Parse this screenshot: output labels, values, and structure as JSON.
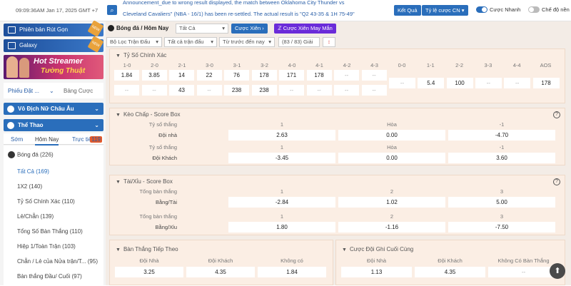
{
  "topbar": {
    "clock": "09:09:36AM Jan 17, 2025 GMT +7",
    "ticker_line1": "Announcement_due to wrong result displayed, the match between  Oklahoma City Thunder  vs",
    "ticker_line2": "Cleveland Cavaliers\" (NBA - 16/1) has been re-settled. The actual result is \"Q2 43-35 & 1H 75-49\"",
    "result_button": "Kết Quả",
    "odds_button": "Tỷ lệ cược CN",
    "odds_chevron": "▾",
    "quick_bet_label": "Cược Nhanh",
    "mode_label": "Chế độ nền",
    "colors": {
      "accent": "#2a6ebb",
      "peach": "#fbeee4"
    }
  },
  "sidebar": {
    "promo1": "Phiên bản Rút Gọn",
    "promo1_tag": "NEW",
    "promo2": "Galaxy",
    "promo2_tag": "NEW",
    "banner_line1": "Hot Streamer",
    "banner_line2": "Tường Thuật",
    "tab_bets": "Phiếu Đặt ...",
    "tab_bets_chevron": "⌄",
    "tab_table": "Bảng Cược",
    "section1": "Vô Địch Nữ Châu Âu",
    "section2": "Thể Thao",
    "chevron": "⌄",
    "sport_tabs": [
      "Sớm",
      "Hôm Nay",
      "Trực tiếp"
    ],
    "live_count": "119",
    "football": "Bóng đá",
    "football_count": "(226)",
    "menu": [
      {
        "label": "Tất Cả",
        "count": "(169)"
      },
      {
        "label": "1X2",
        "count": "(140)"
      },
      {
        "label": "Tỷ Số Chính Xác",
        "count": "(110)"
      },
      {
        "label": "Lẻ/Chẵn",
        "count": "(139)"
      },
      {
        "label": "Tổng Số Bàn Thắng",
        "count": "(110)"
      },
      {
        "label": "Hiệp 1/Toàn Trận",
        "count": "(103)"
      },
      {
        "label": "Chẵn / Lẻ của Nửa trận/T...",
        "count": "(95)"
      },
      {
        "label": "Bàn thắng Đầu/ Cuối",
        "count": "(97)"
      }
    ]
  },
  "main": {
    "crumb": "Bóng đá / Hôm Nay",
    "select_all": "Tất Cả",
    "combo_button": "Cược Xiên",
    "lucky_button": "Cược Xiên May Mắn",
    "arrow": "›",
    "dd": "▾",
    "filter1": "Bộ Lọc Trận Đấu",
    "filter2": "Tất cả trận đấu",
    "filter3": "Từ trước đến nay",
    "filter4": "(83 / 83) Giải",
    "sort_icon": "↕",
    "caret": "▼",
    "help": "?",
    "dash": "--"
  },
  "correct_score": {
    "title": "Tỷ Số Chính Xác",
    "headers": [
      "1-0",
      "2-0",
      "2-1",
      "3-0",
      "3-1",
      "3-2",
      "4-0",
      "4-1",
      "4-2",
      "4-3",
      "0-0",
      "1-1",
      "2-2",
      "3-3",
      "4-4",
      "AOS"
    ],
    "home": [
      "1.84",
      "3.85",
      "14",
      "22",
      "76",
      "178",
      "171",
      "178",
      "--",
      "--"
    ],
    "away": [
      "--",
      "--",
      "43",
      "--",
      "238",
      "238",
      "--",
      "--",
      "--",
      "--"
    ],
    "draws": [
      "--",
      "5.4",
      "100",
      "--",
      "--",
      "178"
    ]
  },
  "handicap": {
    "title": "Kèo Chấp - Score Box",
    "group1": {
      "label": "Tỷ số thắng",
      "h1": "1",
      "h2": "Hòa",
      "h3": "-1",
      "row_label": "Đội nhà",
      "v": [
        "2.63",
        "0.00",
        "-4.70"
      ]
    },
    "group2": {
      "label": "Tỷ số thắng",
      "h1": "1",
      "h2": "Hòa",
      "h3": "-1",
      "row_label": "Đội Khách",
      "v": [
        "-3.45",
        "0.00",
        "3.60"
      ]
    }
  },
  "overunder": {
    "title": "Tài/Xỉu - Score Box",
    "group1": {
      "label": "Tổng bàn thắng",
      "h1": "1",
      "h2": "2",
      "h3": "3",
      "row_label": "Bằng/Tài",
      "v": [
        "-2.84",
        "1.02",
        "5.00"
      ]
    },
    "group2": {
      "label": "Tổng bàn thắng",
      "h1": "1",
      "h2": "2",
      "h3": "3",
      "row_label": "Bằng/Xỉu",
      "v": [
        "1.80",
        "-1.16",
        "-7.50"
      ]
    }
  },
  "next_goal": {
    "title": "Bàn Thắng Tiếp Theo",
    "headers": [
      "Đội Nhà",
      "Đội Khách",
      "Không có"
    ],
    "values": [
      "3.25",
      "4.35",
      "1.84"
    ]
  },
  "last_goal": {
    "title": "Cược Đội Ghi Cuối Cùng",
    "headers": [
      "Đội Nhà",
      "Đội Khách",
      "Không Có Bàn Thắng"
    ],
    "values": [
      "1.13",
      "4.35",
      "--"
    ]
  },
  "scroll_top_icon": "⬆"
}
